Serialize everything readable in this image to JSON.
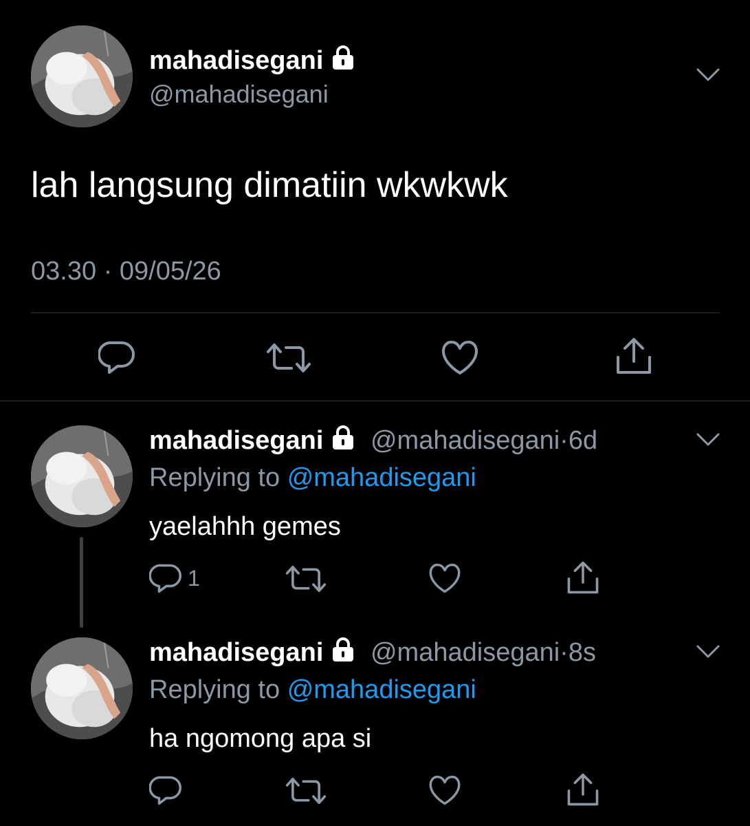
{
  "main_tweet": {
    "display_name": "mahadisegani",
    "handle": "@mahadisegani",
    "text": "lah langsung dimatiin wkwkwk",
    "time": "03.30",
    "separator": "·",
    "date": "09/05/26",
    "icons": {
      "lock": "lock-icon",
      "menu": "chevron-down-icon",
      "reply": "reply-icon",
      "retweet": "retweet-icon",
      "like": "like-icon",
      "share": "share-icon"
    }
  },
  "replies": [
    {
      "display_name": "mahadisegani",
      "handle": "@mahadisegani",
      "separator": "·",
      "age": "6d",
      "replying_prefix": "Replying to",
      "replying_to": "@mahadisegani",
      "text": "yaelahhh gemes",
      "reply_count": "1"
    },
    {
      "display_name": "mahadisegani",
      "handle": "@mahadisegani",
      "separator": "·",
      "age": "8s",
      "replying_prefix": "Replying to",
      "replying_to": "@mahadisegani",
      "text": "ha ngomong apa si",
      "reply_count": ""
    }
  ],
  "colors": {
    "background": "#000000",
    "text": "#ffffff",
    "muted": "#8b98a5",
    "link": "#1d9bf0",
    "divider": "#2f3336"
  }
}
